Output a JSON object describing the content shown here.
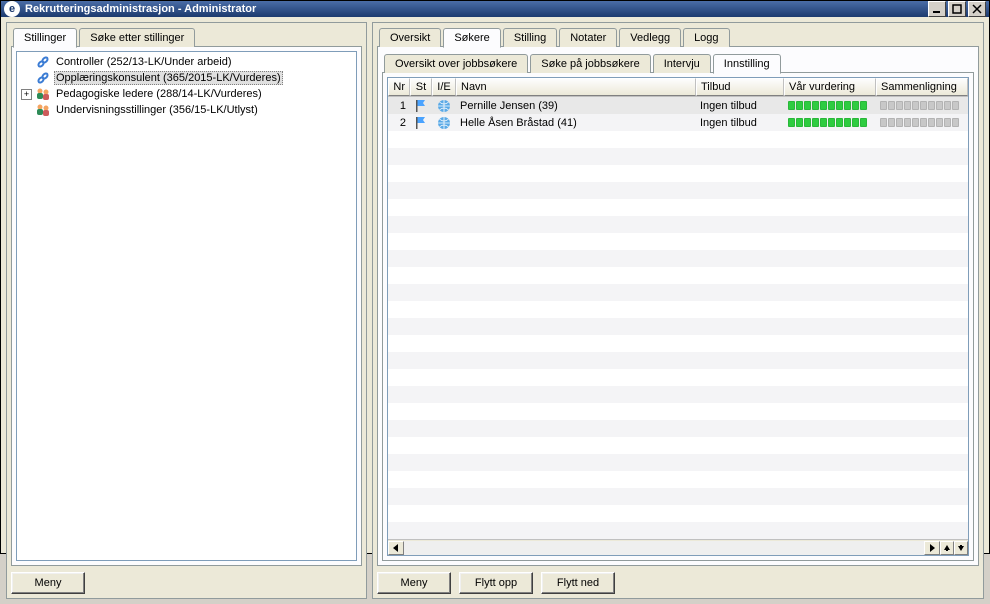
{
  "window": {
    "title": "Rekrutteringsadministrasjon - Administrator"
  },
  "left": {
    "tabs": [
      {
        "label": "Stillinger",
        "active": true
      },
      {
        "label": "Søke etter stillinger",
        "active": false
      }
    ],
    "tree": [
      {
        "exp": "",
        "icon": "chain",
        "label": "Controller (252/13-LK/Under arbeid)",
        "indent": 0,
        "selected": false
      },
      {
        "exp": "",
        "icon": "chain",
        "label": "Opplæringskonsulent (365/2015-LK/Vurderes)",
        "indent": 0,
        "selected": true
      },
      {
        "exp": "+",
        "icon": "people",
        "label": "Pedagogiske ledere (288/14-LK/Vurderes)",
        "indent": 0,
        "selected": false
      },
      {
        "exp": "",
        "icon": "people",
        "label": "Undervisningsstillinger (356/15-LK/Utlyst)",
        "indent": 0,
        "selected": false
      }
    ],
    "menu_btn": "Meny"
  },
  "right": {
    "top_tabs": [
      {
        "label": "Oversikt",
        "active": false
      },
      {
        "label": "Søkere",
        "active": true
      },
      {
        "label": "Stilling",
        "active": false
      },
      {
        "label": "Notater",
        "active": false
      },
      {
        "label": "Vedlegg",
        "active": false
      },
      {
        "label": "Logg",
        "active": false
      }
    ],
    "sub_tabs": [
      {
        "label": "Oversikt over jobbsøkere",
        "active": false
      },
      {
        "label": "Søke på jobbsøkere",
        "active": false
      },
      {
        "label": "Intervju",
        "active": false
      },
      {
        "label": "Innstilling",
        "active": true
      }
    ],
    "grid": {
      "columns": [
        "Nr",
        "St",
        "I/E",
        "Navn",
        "Tilbud",
        "Vår vurdering",
        "Sammenligning"
      ],
      "rows": [
        {
          "nr": "1",
          "navn": "Pernille Jensen (39)",
          "tilbud": "Ingen tilbud",
          "vur": 10,
          "sam": 0,
          "selected": true
        },
        {
          "nr": "2",
          "navn": "Helle Åsen Bråstad (41)",
          "tilbud": "Ingen tilbud",
          "vur": 10,
          "sam": 0,
          "selected": false
        }
      ],
      "vur_max": 10,
      "sam_max": 10
    },
    "buttons": {
      "menu": "Meny",
      "up": "Flytt opp",
      "down": "Flytt ned"
    }
  }
}
